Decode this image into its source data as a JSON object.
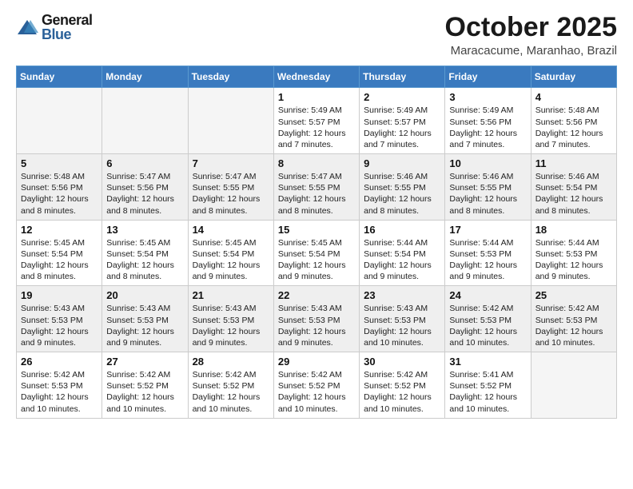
{
  "logo": {
    "general": "General",
    "blue": "Blue"
  },
  "header": {
    "month": "October 2025",
    "location": "Maracacume, Maranhao, Brazil"
  },
  "weekdays": [
    "Sunday",
    "Monday",
    "Tuesday",
    "Wednesday",
    "Thursday",
    "Friday",
    "Saturday"
  ],
  "weeks": [
    [
      {
        "day": "",
        "text": ""
      },
      {
        "day": "",
        "text": ""
      },
      {
        "day": "",
        "text": ""
      },
      {
        "day": "1",
        "text": "Sunrise: 5:49 AM\nSunset: 5:57 PM\nDaylight: 12 hours\nand 7 minutes."
      },
      {
        "day": "2",
        "text": "Sunrise: 5:49 AM\nSunset: 5:57 PM\nDaylight: 12 hours\nand 7 minutes."
      },
      {
        "day": "3",
        "text": "Sunrise: 5:49 AM\nSunset: 5:56 PM\nDaylight: 12 hours\nand 7 minutes."
      },
      {
        "day": "4",
        "text": "Sunrise: 5:48 AM\nSunset: 5:56 PM\nDaylight: 12 hours\nand 7 minutes."
      }
    ],
    [
      {
        "day": "5",
        "text": "Sunrise: 5:48 AM\nSunset: 5:56 PM\nDaylight: 12 hours\nand 8 minutes."
      },
      {
        "day": "6",
        "text": "Sunrise: 5:47 AM\nSunset: 5:56 PM\nDaylight: 12 hours\nand 8 minutes."
      },
      {
        "day": "7",
        "text": "Sunrise: 5:47 AM\nSunset: 5:55 PM\nDaylight: 12 hours\nand 8 minutes."
      },
      {
        "day": "8",
        "text": "Sunrise: 5:47 AM\nSunset: 5:55 PM\nDaylight: 12 hours\nand 8 minutes."
      },
      {
        "day": "9",
        "text": "Sunrise: 5:46 AM\nSunset: 5:55 PM\nDaylight: 12 hours\nand 8 minutes."
      },
      {
        "day": "10",
        "text": "Sunrise: 5:46 AM\nSunset: 5:55 PM\nDaylight: 12 hours\nand 8 minutes."
      },
      {
        "day": "11",
        "text": "Sunrise: 5:46 AM\nSunset: 5:54 PM\nDaylight: 12 hours\nand 8 minutes."
      }
    ],
    [
      {
        "day": "12",
        "text": "Sunrise: 5:45 AM\nSunset: 5:54 PM\nDaylight: 12 hours\nand 8 minutes."
      },
      {
        "day": "13",
        "text": "Sunrise: 5:45 AM\nSunset: 5:54 PM\nDaylight: 12 hours\nand 8 minutes."
      },
      {
        "day": "14",
        "text": "Sunrise: 5:45 AM\nSunset: 5:54 PM\nDaylight: 12 hours\nand 9 minutes."
      },
      {
        "day": "15",
        "text": "Sunrise: 5:45 AM\nSunset: 5:54 PM\nDaylight: 12 hours\nand 9 minutes."
      },
      {
        "day": "16",
        "text": "Sunrise: 5:44 AM\nSunset: 5:54 PM\nDaylight: 12 hours\nand 9 minutes."
      },
      {
        "day": "17",
        "text": "Sunrise: 5:44 AM\nSunset: 5:53 PM\nDaylight: 12 hours\nand 9 minutes."
      },
      {
        "day": "18",
        "text": "Sunrise: 5:44 AM\nSunset: 5:53 PM\nDaylight: 12 hours\nand 9 minutes."
      }
    ],
    [
      {
        "day": "19",
        "text": "Sunrise: 5:43 AM\nSunset: 5:53 PM\nDaylight: 12 hours\nand 9 minutes."
      },
      {
        "day": "20",
        "text": "Sunrise: 5:43 AM\nSunset: 5:53 PM\nDaylight: 12 hours\nand 9 minutes."
      },
      {
        "day": "21",
        "text": "Sunrise: 5:43 AM\nSunset: 5:53 PM\nDaylight: 12 hours\nand 9 minutes."
      },
      {
        "day": "22",
        "text": "Sunrise: 5:43 AM\nSunset: 5:53 PM\nDaylight: 12 hours\nand 9 minutes."
      },
      {
        "day": "23",
        "text": "Sunrise: 5:43 AM\nSunset: 5:53 PM\nDaylight: 12 hours\nand 10 minutes."
      },
      {
        "day": "24",
        "text": "Sunrise: 5:42 AM\nSunset: 5:53 PM\nDaylight: 12 hours\nand 10 minutes."
      },
      {
        "day": "25",
        "text": "Sunrise: 5:42 AM\nSunset: 5:53 PM\nDaylight: 12 hours\nand 10 minutes."
      }
    ],
    [
      {
        "day": "26",
        "text": "Sunrise: 5:42 AM\nSunset: 5:53 PM\nDaylight: 12 hours\nand 10 minutes."
      },
      {
        "day": "27",
        "text": "Sunrise: 5:42 AM\nSunset: 5:52 PM\nDaylight: 12 hours\nand 10 minutes."
      },
      {
        "day": "28",
        "text": "Sunrise: 5:42 AM\nSunset: 5:52 PM\nDaylight: 12 hours\nand 10 minutes."
      },
      {
        "day": "29",
        "text": "Sunrise: 5:42 AM\nSunset: 5:52 PM\nDaylight: 12 hours\nand 10 minutes."
      },
      {
        "day": "30",
        "text": "Sunrise: 5:42 AM\nSunset: 5:52 PM\nDaylight: 12 hours\nand 10 minutes."
      },
      {
        "day": "31",
        "text": "Sunrise: 5:41 AM\nSunset: 5:52 PM\nDaylight: 12 hours\nand 10 minutes."
      },
      {
        "day": "",
        "text": ""
      }
    ]
  ]
}
